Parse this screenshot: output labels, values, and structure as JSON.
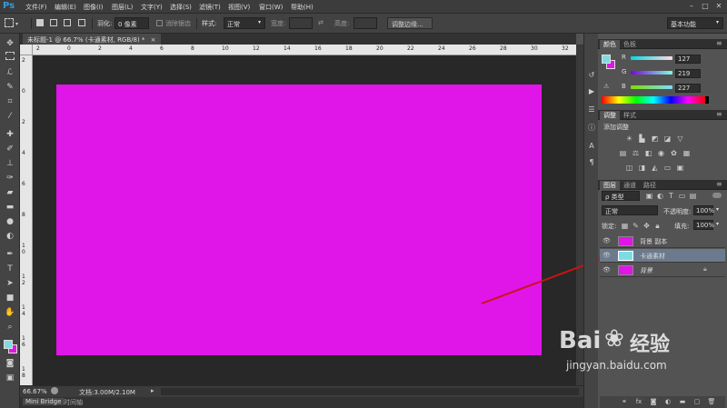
{
  "app": {
    "logo": "Ps"
  },
  "menubar": {
    "items": [
      "文件(F)",
      "编辑(E)",
      "图像(I)",
      "图层(L)",
      "文字(Y)",
      "选择(S)",
      "滤镜(T)",
      "视图(V)",
      "窗口(W)",
      "帮助(H)"
    ],
    "window_controls": [
      "–",
      "□",
      "✕"
    ]
  },
  "options": {
    "feather_label": "羽化:",
    "feather_value": "0 像素",
    "antialias_label": "消除锯齿",
    "style_label": "样式:",
    "style_value": "正常",
    "width_label": "宽度:",
    "height_label": "高度:",
    "refine_edge": "调整边缘...",
    "workspace": "基本功能"
  },
  "document": {
    "tab_title": "未标题-1 @ 66.7% (卡通素材, RGB/8) *",
    "tab_close": "×",
    "canvas_color": "#e015e7",
    "ruler_top": [
      "2",
      "0",
      "2",
      "4",
      "6",
      "8",
      "10",
      "12",
      "14",
      "16",
      "18",
      "20",
      "22",
      "24",
      "26",
      "28",
      "30",
      "32"
    ],
    "ruler_left": [
      "2",
      "0",
      "2",
      "4",
      "6",
      "8",
      "1 0",
      "1 2",
      "1 4",
      "1 6",
      "1 8"
    ]
  },
  "status": {
    "zoom": "66.67%",
    "doc_info": "文档:3.00M/2.10M"
  },
  "bottom_tabs": [
    "Mini Bridge",
    "时间轴"
  ],
  "color_panel": {
    "tabs": [
      "颜色",
      "色板"
    ],
    "channels": [
      {
        "label": "R",
        "value": "127"
      },
      {
        "label": "G",
        "value": "219"
      },
      {
        "label": "B",
        "value": "227"
      }
    ],
    "foreground": "#7fdbe3",
    "background": "#e015e7"
  },
  "adjust_panel": {
    "tabs": [
      "调整",
      "样式"
    ],
    "heading": "添加调整"
  },
  "layers_panel": {
    "tabs": [
      "图层",
      "通道",
      "路径"
    ],
    "filter_label": "ρ 类型",
    "blend_mode": "正常",
    "opacity_label": "不透明度:",
    "opacity_value": "100%",
    "lock_label": "锁定:",
    "fill_label": "填充:",
    "fill_value": "100%",
    "layers": [
      {
        "name": "背景 副本",
        "color": "#e015e7",
        "selected": false
      },
      {
        "name": "卡通素材",
        "color": "#7fdbe3",
        "selected": true
      },
      {
        "name": "背景",
        "color": "#e015e7",
        "selected": false
      }
    ],
    "footer_icons": [
      "link-icon",
      "fx-icon",
      "mask-icon",
      "adjustment-icon",
      "group-icon",
      "new-layer-icon",
      "trash-icon"
    ]
  },
  "watermark": {
    "brand": "Bai",
    "brand2": "经验",
    "url": "jingyan.baidu.com"
  }
}
